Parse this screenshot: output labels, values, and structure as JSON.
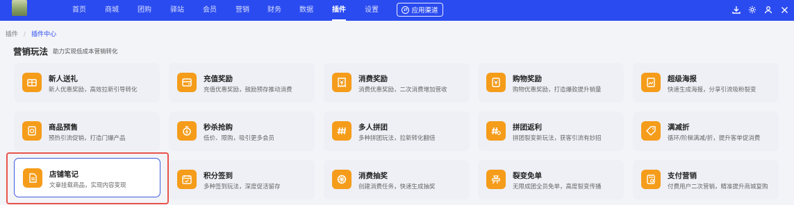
{
  "topbar": {
    "nav": [
      "首页",
      "商城",
      "团购",
      "驿站",
      "会员",
      "营销",
      "财务",
      "数据",
      "插件",
      "设置"
    ],
    "active_index": 8,
    "channel_label": "应用渠道",
    "icons": [
      "download-icon",
      "gear-icon",
      "user-icon",
      "close-icon"
    ]
  },
  "breadcrumb": {
    "root": "插件",
    "separator": "/",
    "current": "插件中心"
  },
  "section": {
    "title": "营销玩法",
    "subtitle": "助力实现低成本营销转化"
  },
  "colors": {
    "nav_bg": "#2a4bf0",
    "icon_bg": "#f59c1a",
    "card_bg": "#eef0f6",
    "highlight": "#e8534a",
    "selected_border": "#3b5bdb"
  },
  "cards": [
    [
      {
        "name": "新人送礼",
        "desc": "新人优惠奖励，高效拉新引导转化",
        "icon": "gift-card-icon"
      },
      {
        "name": "充值奖励",
        "desc": "充值优惠奖励，鼓励预存推动消费",
        "icon": "wallet-icon"
      },
      {
        "name": "消费奖励",
        "desc": "消费优惠奖励，二次消费增加营收",
        "icon": "receipt-icon"
      },
      {
        "name": "购物奖励",
        "desc": "购物优惠奖励，打造爆款提升销量",
        "icon": "shopping-reward-icon"
      },
      {
        "name": "超级海报",
        "desc": "快速生成海报，分享引流吸粉裂变",
        "icon": "poster-icon"
      }
    ],
    [
      {
        "name": "商品预售",
        "desc": "预热引流促销，打造门爆产品",
        "icon": "presale-icon"
      },
      {
        "name": "秒杀抢购",
        "desc": "低价、限购，吸引更多会员",
        "icon": "flash-sale-icon"
      },
      {
        "name": "多人拼团",
        "desc": "多种拼团玩法，拉新转化翻倍",
        "icon": "group-buy-icon"
      },
      {
        "name": "拼团返利",
        "desc": "拼团裂变新玩法，获客引流有妙招",
        "icon": "group-rebate-icon"
      },
      {
        "name": "满减折",
        "desc": "循环/阶梯满减/折，提升客单促消费",
        "icon": "discount-tag-icon"
      }
    ],
    [
      {
        "name": "店铺笔记",
        "desc": "文章挂载商品，实现内容变现",
        "icon": "note-icon"
      },
      {
        "name": "积分签到",
        "desc": "多种签到玩法，深度促活留存",
        "icon": "checkin-icon"
      },
      {
        "name": "消费抽奖",
        "desc": "创建消费任务，快速生成抽奖",
        "icon": "lottery-wheel-icon"
      },
      {
        "name": "裂变免单",
        "desc": "无限成团全员免单，高度裂变传播",
        "icon": "free-order-icon"
      },
      {
        "name": "支付营销",
        "desc": "付费用户二次营销，精准提升商城复购",
        "icon": "payment-marketing-icon"
      }
    ]
  ]
}
